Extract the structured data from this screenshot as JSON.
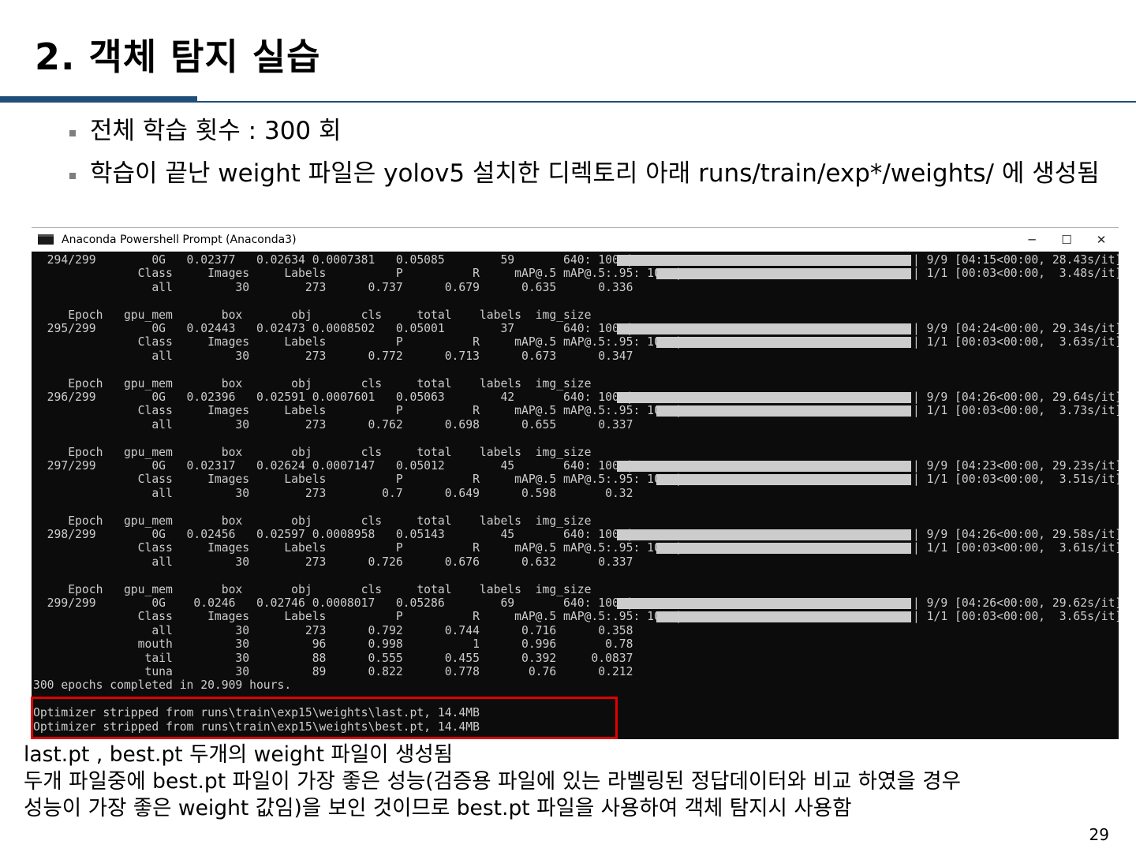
{
  "slide": {
    "title": "2. 객체 탐지 실습",
    "bullets": [
      "전체 학습 횟수 : 300 회",
      "학습이 끝난 weight 파일은 yolov5 설치한 디렉토리 아래 runs/train/exp*/weights/ 에 생성됨"
    ],
    "caption_lines": [
      "last.pt , best.pt   두개의 weight 파일이 생성됨",
      "두개 파일중에 best.pt 파일이 가장 좋은 성능(검증용 파일에 있는 라벨링된 정답데이터와 비교 하였을 경우",
      "성능이 가장 좋은 weight 값임)을 보인 것이므로 best.pt 파일을 사용하여 객체 탐지시 사용함"
    ],
    "page_number": "29"
  },
  "terminal": {
    "window_title": "Anaconda Powershell Prompt (Anaconda3)",
    "controls": {
      "minimize": "─",
      "maximize": "☐",
      "close": "✕"
    },
    "lines": [
      "  294/299        0G   0.02377   0.02634 0.0007381   0.05085        59       640: 100%|",
      "               Class     Images     Labels          P          R     mAP@.5 mAP@.5:.95: 100%|",
      "                 all         30        273      0.737      0.679      0.635      0.336",
      "",
      "     Epoch   gpu_mem       box       obj       cls     total    labels  img_size",
      "  295/299        0G   0.02443   0.02473 0.0008502   0.05001        37       640: 100%|",
      "               Class     Images     Labels          P          R     mAP@.5 mAP@.5:.95: 100%|",
      "                 all         30        273      0.772      0.713      0.673      0.347",
      "",
      "     Epoch   gpu_mem       box       obj       cls     total    labels  img_size",
      "  296/299        0G   0.02396   0.02591 0.0007601   0.05063        42       640: 100%|",
      "               Class     Images     Labels          P          R     mAP@.5 mAP@.5:.95: 100%|",
      "                 all         30        273      0.762      0.698      0.655      0.337",
      "",
      "     Epoch   gpu_mem       box       obj       cls     total    labels  img_size",
      "  297/299        0G   0.02317   0.02624 0.0007147   0.05012        45       640: 100%|",
      "               Class     Images     Labels          P          R     mAP@.5 mAP@.5:.95: 100%|",
      "                 all         30        273        0.7      0.649      0.598       0.32",
      "",
      "     Epoch   gpu_mem       box       obj       cls     total    labels  img_size",
      "  298/299        0G   0.02456   0.02597 0.0008958   0.05143        45       640: 100%|",
      "               Class     Images     Labels          P          R     mAP@.5 mAP@.5:.95: 100%|",
      "                 all         30        273      0.726      0.676      0.632      0.337",
      "",
      "     Epoch   gpu_mem       box       obj       cls     total    labels  img_size",
      "  299/299        0G    0.0246   0.02746 0.0008017   0.05286        69       640: 100%|",
      "               Class     Images     Labels          P          R     mAP@.5 mAP@.5:.95: 100%|",
      "                 all         30        273      0.792      0.744      0.716      0.358",
      "               mouth         30         96      0.998          1      0.996       0.78",
      "                tail         30         88      0.555      0.455      0.392     0.0837",
      "                tuna         30         89      0.822      0.778       0.76      0.212",
      "300 epochs completed in 20.909 hours.",
      "",
      "Optimizer stripped from runs\\train\\exp15\\weights\\last.pt, 14.4MB",
      "Optimizer stripped from runs\\train\\exp15\\weights\\best.pt, 14.4MB"
    ],
    "progress_rows": [
      {
        "line": 0,
        "type": "train",
        "suffix": "| 9/9 [04:15<00:00, 28.43s/it]"
      },
      {
        "line": 1,
        "type": "val",
        "suffix": "| 1/1 [00:03<00:00,  3.48s/it]"
      },
      {
        "line": 5,
        "type": "train",
        "suffix": "| 9/9 [04:24<00:00, 29.34s/it]"
      },
      {
        "line": 6,
        "type": "val",
        "suffix": "| 1/1 [00:03<00:00,  3.63s/it]"
      },
      {
        "line": 10,
        "type": "train",
        "suffix": "| 9/9 [04:26<00:00, 29.64s/it]"
      },
      {
        "line": 11,
        "type": "val",
        "suffix": "| 1/1 [00:03<00:00,  3.73s/it]"
      },
      {
        "line": 15,
        "type": "train",
        "suffix": "| 9/9 [04:23<00:00, 29.23s/it]"
      },
      {
        "line": 16,
        "type": "val",
        "suffix": "| 1/1 [00:03<00:00,  3.51s/it]"
      },
      {
        "line": 20,
        "type": "train",
        "suffix": "| 9/9 [04:26<00:00, 29.58s/it]"
      },
      {
        "line": 21,
        "type": "val",
        "suffix": "| 1/1 [00:03<00:00,  3.61s/it]"
      },
      {
        "line": 25,
        "type": "train",
        "suffix": "| 9/9 [04:26<00:00, 29.62s/it]"
      },
      {
        "line": 26,
        "type": "val",
        "suffix": "| 1/1 [00:03<00:00,  3.65s/it]"
      }
    ],
    "progress_fraction": 1.0
  },
  "colors": {
    "accent": "#1f4e79",
    "terminal_bg": "#0c0c0c",
    "terminal_text": "#cccccc",
    "highlight_box": "#e00000"
  }
}
